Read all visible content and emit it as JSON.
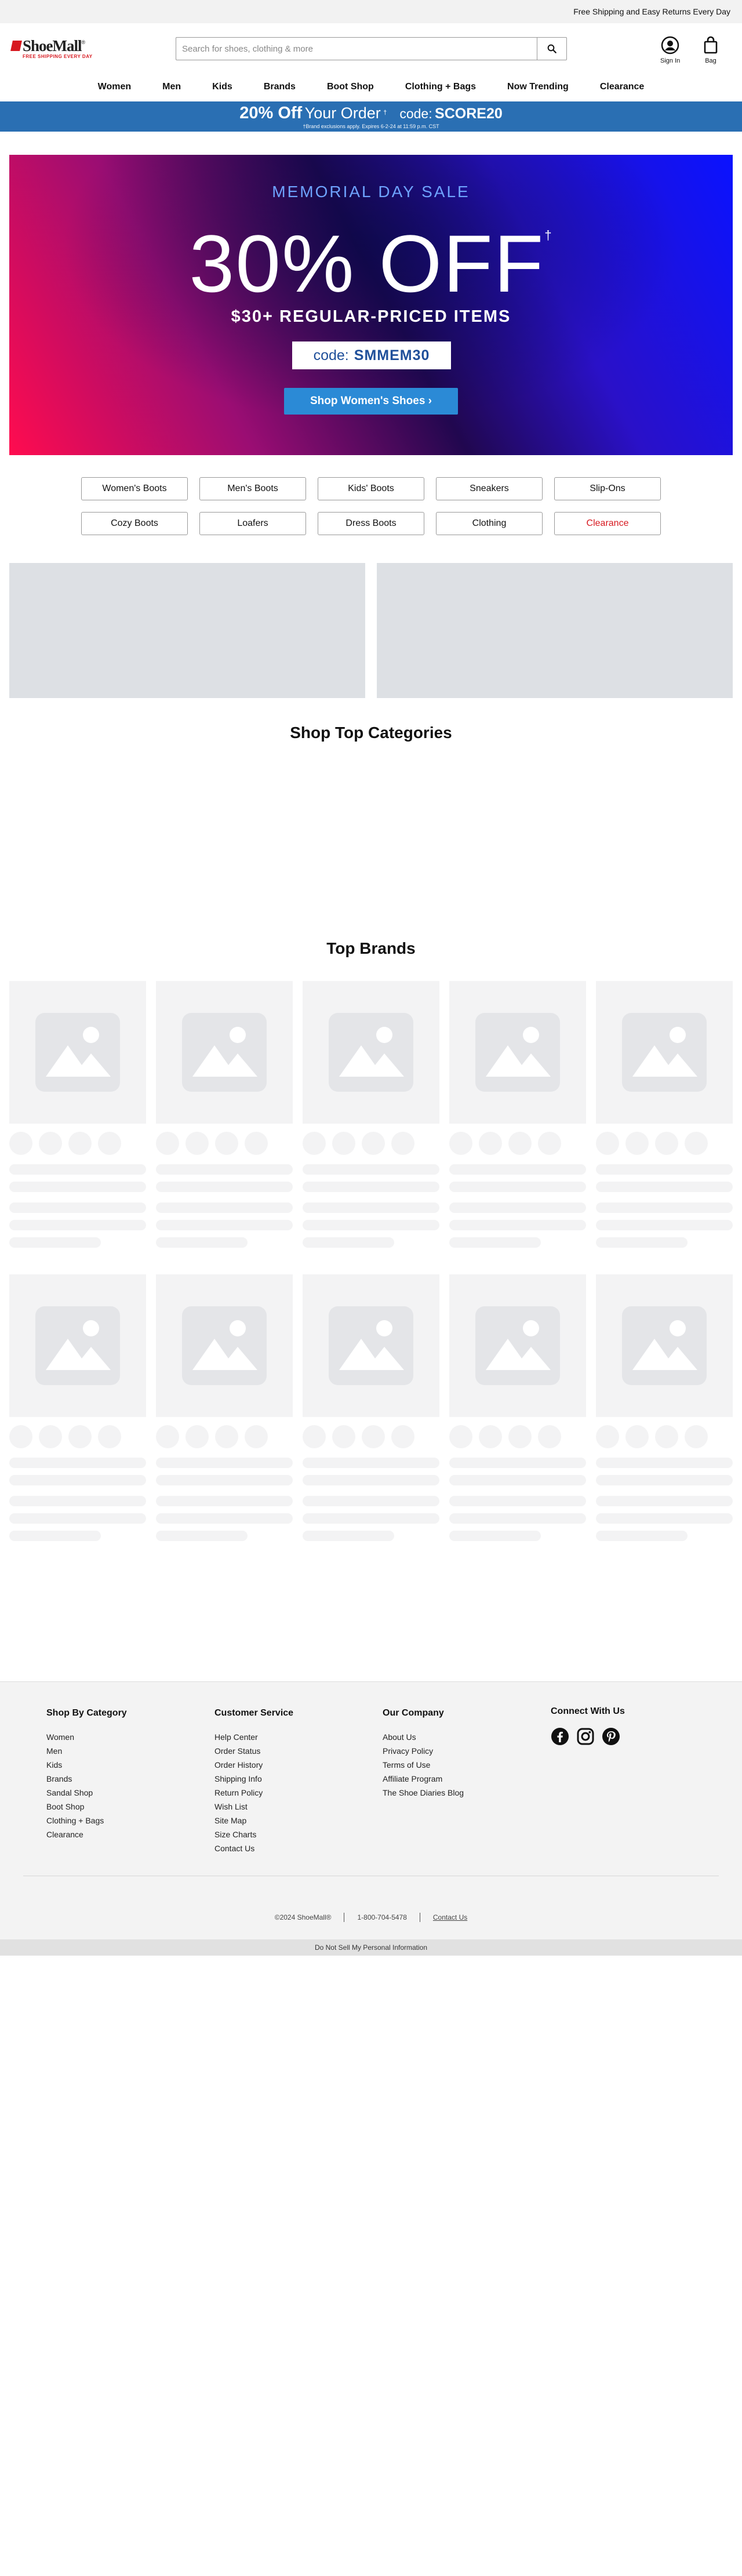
{
  "top_strip": {
    "text": "Free Shipping and Easy Returns Every Day"
  },
  "header": {
    "logo_text": "ShoeMall",
    "logo_reg": "®",
    "logo_tagline": "FREE SHIPPING EVERY DAY",
    "search_placeholder": "Search for shoes, clothing & more",
    "signin_label": "Sign In",
    "bag_label": "Bag"
  },
  "nav": {
    "items": [
      {
        "label": "Women"
      },
      {
        "label": "Men"
      },
      {
        "label": "Kids"
      },
      {
        "label": "Brands"
      },
      {
        "label": "Boot Shop"
      },
      {
        "label": "Clothing + Bags"
      },
      {
        "label": "Now Trending"
      },
      {
        "label": "Clearance"
      }
    ]
  },
  "promo_bar": {
    "big": "20% Off",
    "rest": "Your Order",
    "dagger": "†",
    "code_label": "code:",
    "code": "SCORE20",
    "fine_print": "†Brand exclusions apply. Expires 6-2-24 at 11:59 p.m. CST"
  },
  "hero": {
    "event": "MEMORIAL DAY SALE",
    "title": "30% OFF",
    "dagger": "†",
    "subtitle": "$30+ REGULAR-PRICED ITEMS",
    "code_label": "code:",
    "code": "SMMEM30",
    "cta": "Shop Women's Shoes ›"
  },
  "category_pills": [
    {
      "label": "Women's Boots"
    },
    {
      "label": "Men's Boots"
    },
    {
      "label": "Kids' Boots"
    },
    {
      "label": "Sneakers"
    },
    {
      "label": "Slip-Ons"
    },
    {
      "label": "Cozy Boots"
    },
    {
      "label": "Loafers"
    },
    {
      "label": "Dress Boots"
    },
    {
      "label": "Clothing"
    },
    {
      "label": "Clearance"
    }
  ],
  "sections": {
    "top_categories": "Shop Top Categories",
    "top_brands": "Top Brands"
  },
  "footer": {
    "columns": [
      {
        "heading": "Shop By Category",
        "links": [
          "Women",
          "Men",
          "Kids",
          "Brands",
          "Sandal Shop",
          "Boot Shop",
          "Clothing + Bags",
          "Clearance"
        ]
      },
      {
        "heading": "Customer Service",
        "links": [
          "Help Center",
          "Order Status",
          "Order History",
          "Shipping Info",
          "Return Policy",
          "Wish List",
          "Site Map",
          "Size Charts",
          "Contact Us"
        ]
      },
      {
        "heading": "Our Company",
        "links": [
          "About Us",
          "Privacy Policy",
          "Terms of Use",
          "Affiliate Program",
          "The Shoe Diaries Blog"
        ]
      }
    ],
    "connect_heading": "Connect With Us",
    "copyright": "©2024 ShoeMall®",
    "phone": "1-800-704-5478",
    "contact": "Contact Us",
    "do_not_sell": "Do Not Sell My Personal Information"
  },
  "colors": {
    "brand_red": "#d71920",
    "promo_blue": "#2a6fb3",
    "cta_blue": "#2b8ad6",
    "skeleton": "#f3f3f4",
    "placeholder": "#dde0e4"
  }
}
